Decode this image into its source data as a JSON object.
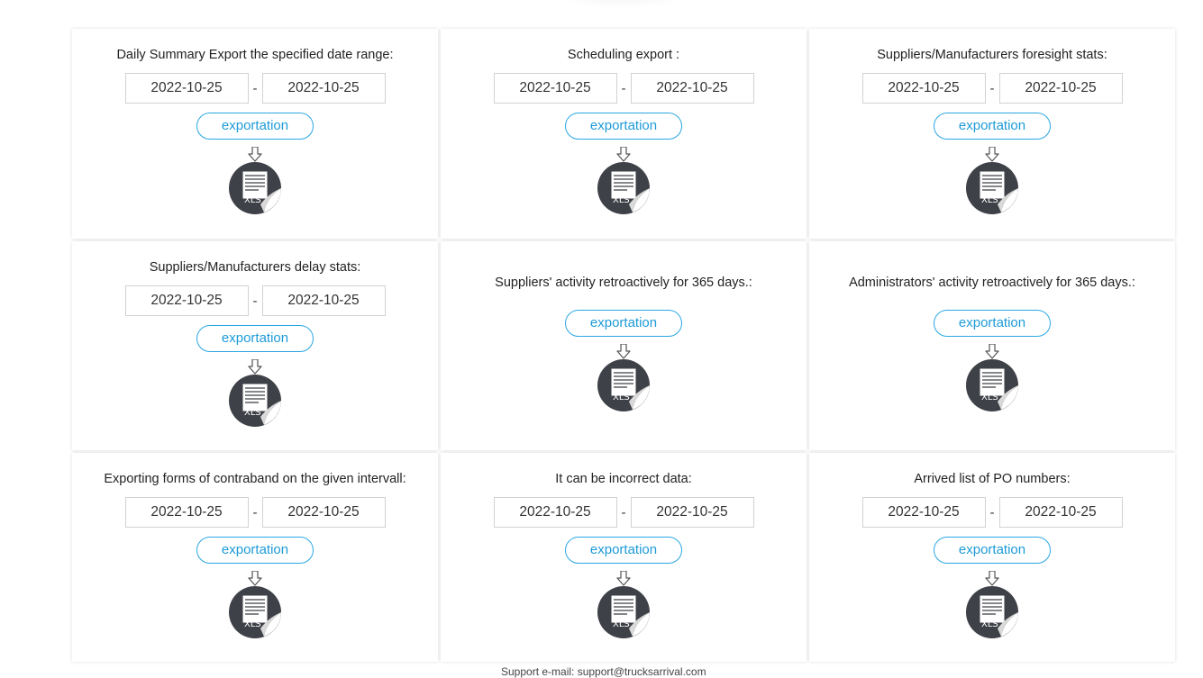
{
  "cards": [
    {
      "title": "Daily Summary Export the specified date range:",
      "date_from": "2022-10-25",
      "date_to": "2022-10-25",
      "button": "exportation",
      "icon": "xls-file-icon",
      "icon_text": "XLS"
    },
    {
      "title": "Scheduling export :",
      "date_from": "2022-10-25",
      "date_to": "2022-10-25",
      "button": "exportation",
      "icon": "xls-file-icon",
      "icon_text": "XLS"
    },
    {
      "title": "Suppliers/Manufacturers foresight stats:",
      "date_from": "2022-10-25",
      "date_to": "2022-10-25",
      "button": "exportation",
      "icon": "xls-file-icon",
      "icon_text": "XLS"
    },
    {
      "title": "Suppliers/Manufacturers delay stats:",
      "date_from": "2022-10-25",
      "date_to": "2022-10-25",
      "button": "exportation",
      "icon": "xls-file-icon",
      "icon_text": "XLS"
    },
    {
      "title": "Suppliers' activity retroactively for 365 days.:",
      "button": "exportation",
      "icon": "xls-file-icon",
      "icon_text": "XLS"
    },
    {
      "title": "Administrators' activity retroactively for 365 days.:",
      "button": "exportation",
      "icon": "xls-file-icon",
      "icon_text": "XLS"
    },
    {
      "title": "Exporting forms of contraband on the given intervall:",
      "date_from": "2022-10-25",
      "date_to": "2022-10-25",
      "button": "exportation",
      "icon": "xls-file-icon",
      "icon_text": "XLS"
    },
    {
      "title": "It can be incorrect data:",
      "date_from": "2022-10-25",
      "date_to": "2022-10-25",
      "button": "exportation",
      "icon": "xls-file-icon",
      "icon_text": "XLS"
    },
    {
      "title": "Arrived list of PO numbers:",
      "date_from": "2022-10-25",
      "date_to": "2022-10-25",
      "button": "exportation",
      "icon": "xls-file-icon",
      "icon_text": "XLS"
    }
  ],
  "date_separator": "-",
  "footer": {
    "text": "Support e-mail: support@trucksarrival.com"
  },
  "colors": {
    "accent": "#1d9bd8",
    "icon_dark": "#3f4148",
    "border": "#d2d2d2"
  }
}
